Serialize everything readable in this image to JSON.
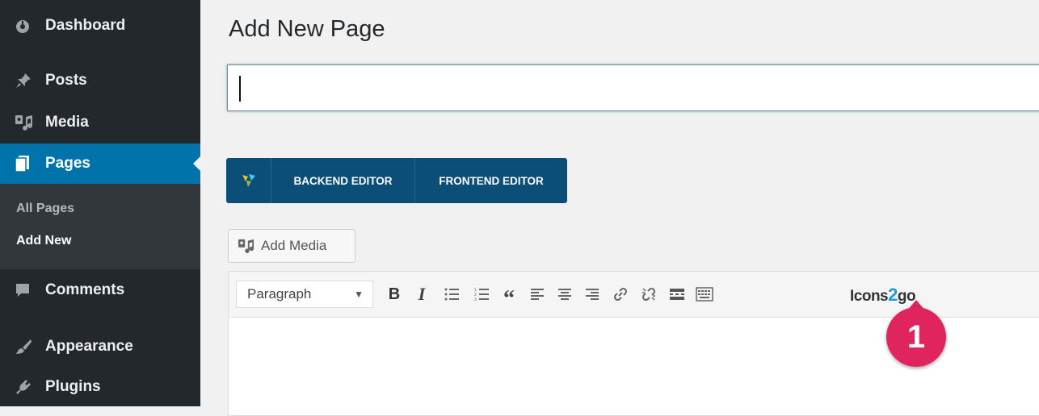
{
  "sidebar": {
    "items": [
      {
        "id": "dashboard",
        "label": "Dashboard",
        "icon": "dashboard-icon"
      },
      {
        "id": "posts",
        "label": "Posts",
        "icon": "pushpin-icon"
      },
      {
        "id": "media",
        "label": "Media",
        "icon": "media-icon"
      },
      {
        "id": "pages",
        "label": "Pages",
        "icon": "pages-icon"
      },
      {
        "id": "comments",
        "label": "Comments",
        "icon": "comment-icon"
      },
      {
        "id": "appearance",
        "label": "Appearance",
        "icon": "paintbrush-icon"
      },
      {
        "id": "plugins",
        "label": "Plugins",
        "icon": "plugin-icon"
      }
    ],
    "submenu": [
      {
        "label": "All Pages"
      },
      {
        "label": "Add New"
      }
    ],
    "current_color": "#0073aa",
    "background": "#23282d"
  },
  "main": {
    "title": "Add New Page",
    "title_input_value": "",
    "page_builder": {
      "backend_label": "BACKEND EDITOR",
      "frontend_label": "FRONTEND EDITOR"
    },
    "add_media_label": "Add Media",
    "editor": {
      "format_select": "Paragraph",
      "plugin_label_prefix": "Icons",
      "plugin_label_number": "2",
      "plugin_label_suffix": "go"
    },
    "callout_number": "1",
    "callout_color": "#e0245e"
  }
}
